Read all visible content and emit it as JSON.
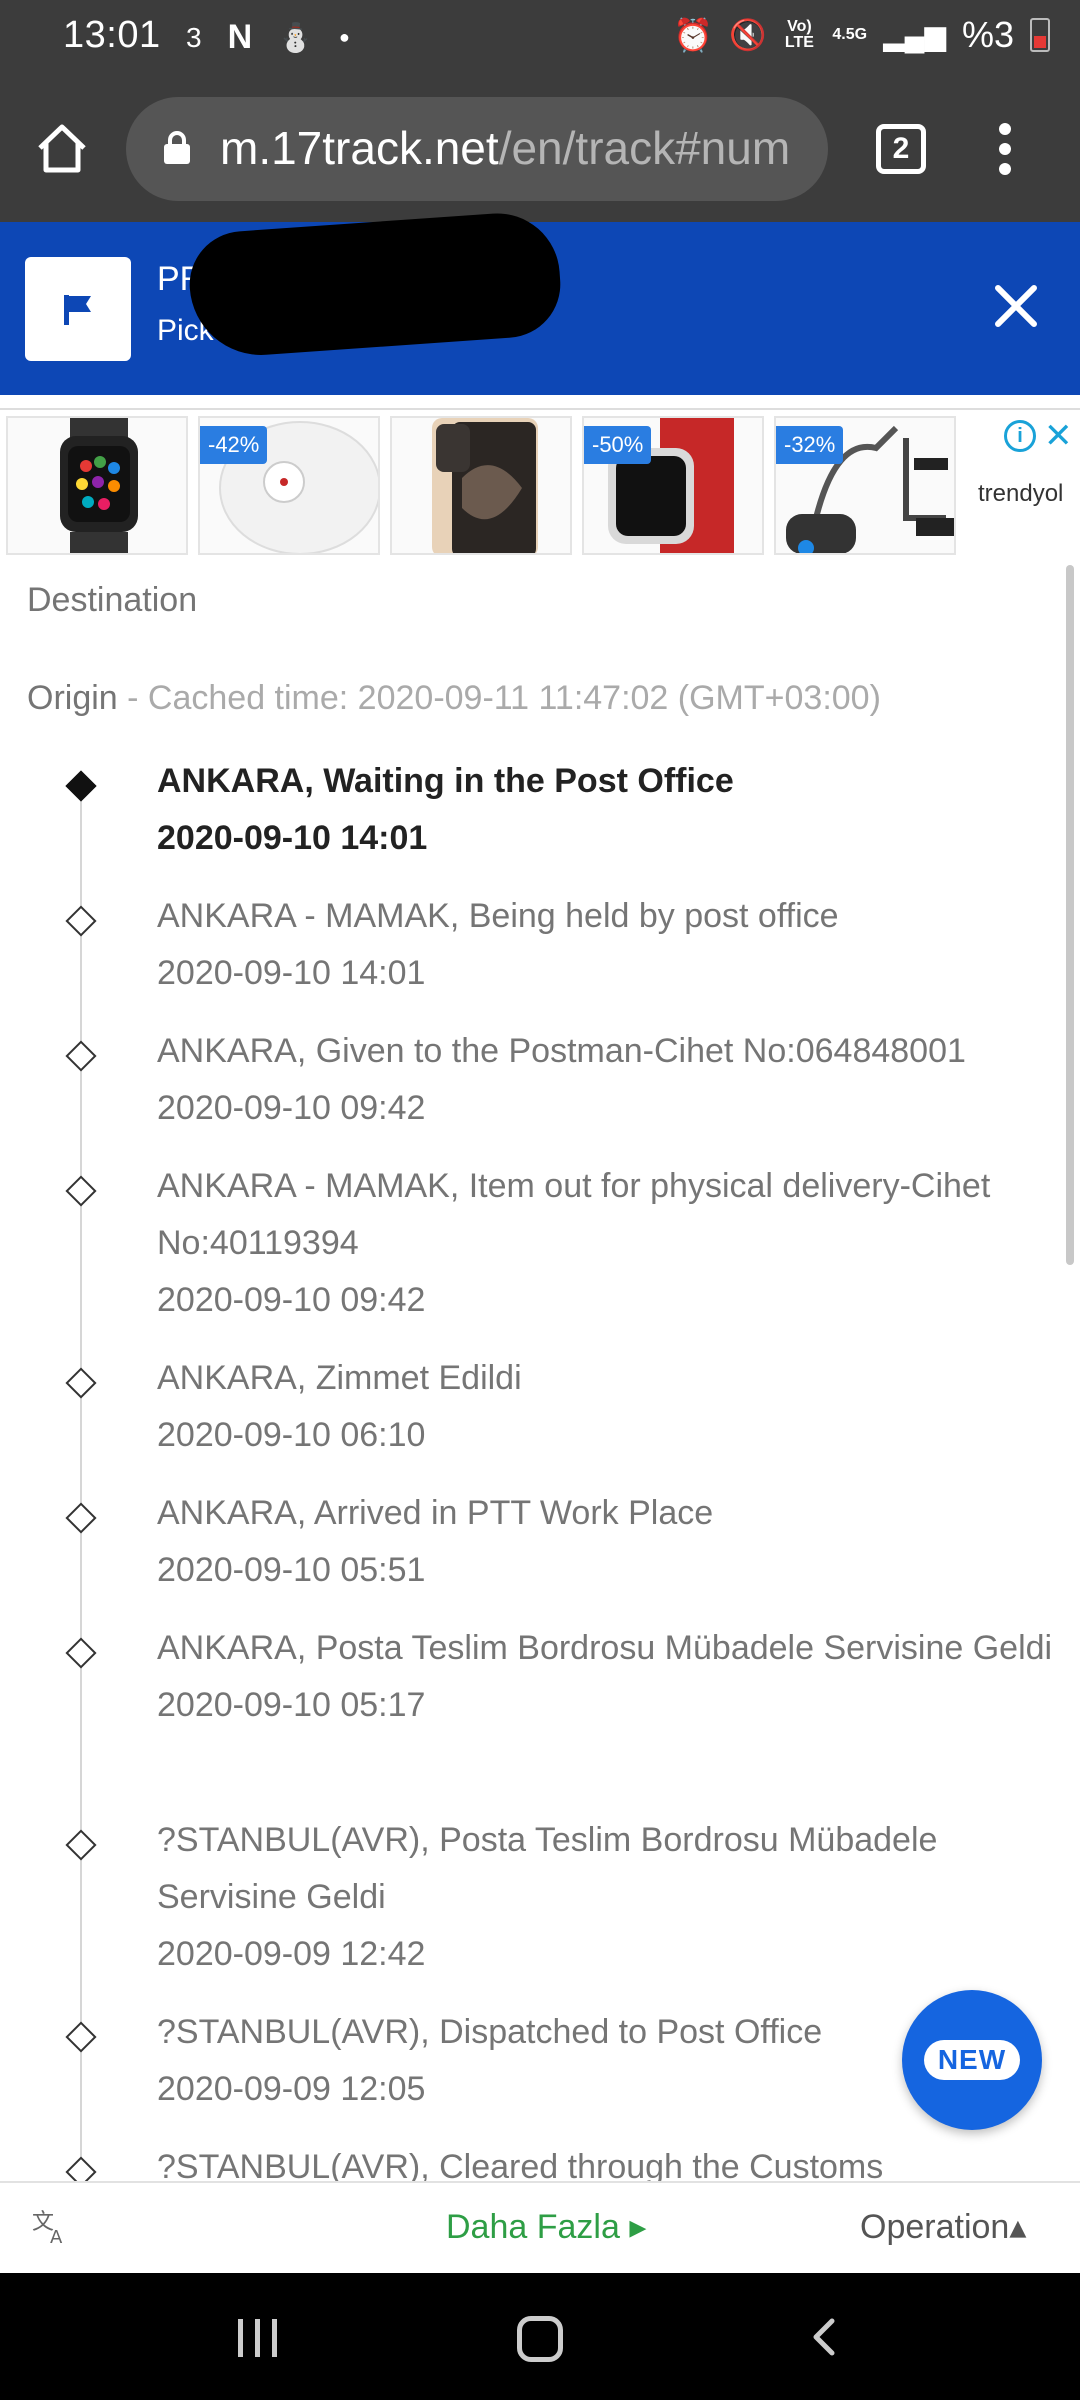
{
  "status_bar": {
    "time": "13:01",
    "notification_count": "3",
    "lte_label": "Vo) LTE",
    "network_label": "4.5G",
    "battery": "%3"
  },
  "browser": {
    "url_host": "m.17track.net",
    "url_path": "/en/track#num",
    "tab_count": "2"
  },
  "banner": {
    "title": "PR",
    "subtitle": "Pick up",
    "color": "#0d47b5"
  },
  "ad": {
    "discounts": [
      "-42%",
      "-50%",
      "-32%"
    ],
    "brand": "trendyol"
  },
  "tracking": {
    "destination_label": "Destination",
    "origin_label": "Origin",
    "cached_time": " - Cached time: 2020-09-11 11:47:02 (GMT+03:00)",
    "events": [
      {
        "description": "ANKARA, Waiting in the Post Office",
        "time": "2020-09-10 14:01"
      },
      {
        "description": "ANKARA - MAMAK, Being held by post office",
        "time": "2020-09-10 14:01"
      },
      {
        "description": "ANKARA, Given to the Postman-Cihet No:064848001",
        "time": "2020-09-10 09:42"
      },
      {
        "description": "ANKARA - MAMAK, Item out for physical delivery-Cihet No:40119394",
        "time": "2020-09-10 09:42"
      },
      {
        "description": "ANKARA, Zimmet Edildi",
        "time": "2020-09-10 06:10"
      },
      {
        "description": "ANKARA, Arrived in PTT Work Place",
        "time": "2020-09-10 05:51"
      },
      {
        "description": "ANKARA, Posta Teslim Bordrosu Mübadele Servisine Geldi",
        "time": "2020-09-10 05:17"
      },
      {
        "description": "?STANBUL(AVR), Posta Teslim Bordrosu Mübadele Servisine Geldi",
        "time": "2020-09-09 12:42"
      },
      {
        "description": "?STANBUL(AVR), Dispatched to Post Office",
        "time": "2020-09-09 12:05"
      },
      {
        "description": "?STANBUL(AVR), Cleared through the Customs",
        "time": ""
      }
    ]
  },
  "fab": {
    "label": "NEW"
  },
  "toolbar": {
    "more_label": "Daha Fazla ▸",
    "operation_label": "Operation▴"
  }
}
